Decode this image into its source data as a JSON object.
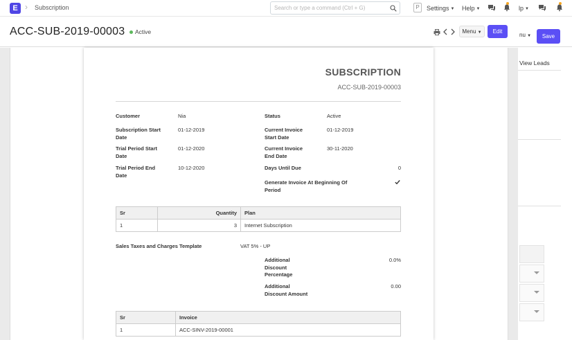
{
  "navbar": {
    "logo_letter": "E",
    "breadcrumb": "Subscription",
    "search_placeholder": "Search or type a command (Ctrl + G)",
    "p_badge": "P",
    "settings_label": "Settings",
    "help_label": "Help",
    "ghost_help": "lp"
  },
  "header": {
    "title": "ACC-SUB-2019-00003",
    "status": "Active",
    "status_color": "#5cb85c",
    "menu_label": "Menu",
    "edit_label": "Edit",
    "ghost_menu_label": "nu",
    "save_label": "Save",
    "accent_color": "#5b4ff5"
  },
  "ghost_panel": {
    "view_leads": "View Leads"
  },
  "print": {
    "heading": "SUBSCRIPTION",
    "doc_id": "ACC-SUB-2019-00003",
    "fields_left": [
      {
        "label": "Customer",
        "value": "Nia"
      },
      {
        "label": "Subscription Start Date",
        "value": "01-12-2019"
      },
      {
        "label": "Trial Period Start Date",
        "value": "01-12-2020"
      },
      {
        "label": "Trial Period End Date",
        "value": "10-12-2020"
      }
    ],
    "fields_right": [
      {
        "label": "Status",
        "value": "Active"
      },
      {
        "label": "Current Invoice Start Date",
        "value": "01-12-2019"
      },
      {
        "label": "Current Invoice End Date",
        "value": "30-11-2020"
      },
      {
        "label": "Days Until Due",
        "value": "0"
      },
      {
        "label": "Generate Invoice At Beginning Of Period",
        "value": "check-icon"
      }
    ],
    "plans_table": {
      "headers": [
        "Sr",
        "Quantity",
        "Plan"
      ],
      "rows": [
        [
          "1",
          "3",
          "Internet Subscription"
        ]
      ]
    },
    "taxes_label": "Sales Taxes and Charges Template",
    "taxes_value": "VAT 5% - UP",
    "discount_pct_label": "Additional Discount Percentage",
    "discount_pct_value": "0.0%",
    "discount_amt_label": "Additional Discount Amount",
    "discount_amt_value": "0.00",
    "invoices_table": {
      "headers": [
        "Sr",
        "Invoice"
      ],
      "rows": [
        [
          "1",
          "ACC-SINV-2019-00001"
        ]
      ]
    }
  }
}
